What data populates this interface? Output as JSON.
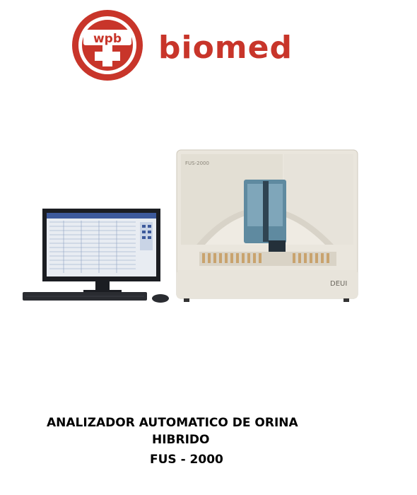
{
  "logo": {
    "emblem_text": "wpb",
    "brand_name": "biomed",
    "brand_color": "#c8352a"
  },
  "product_image": {
    "panel_label": "FUS-2000",
    "maker_mark": "DEUI"
  },
  "caption": {
    "line1": "ANALIZADOR AUTOMATICO DE ORINA",
    "line2": "HIBRIDO",
    "line3": "FUS - 2000"
  }
}
